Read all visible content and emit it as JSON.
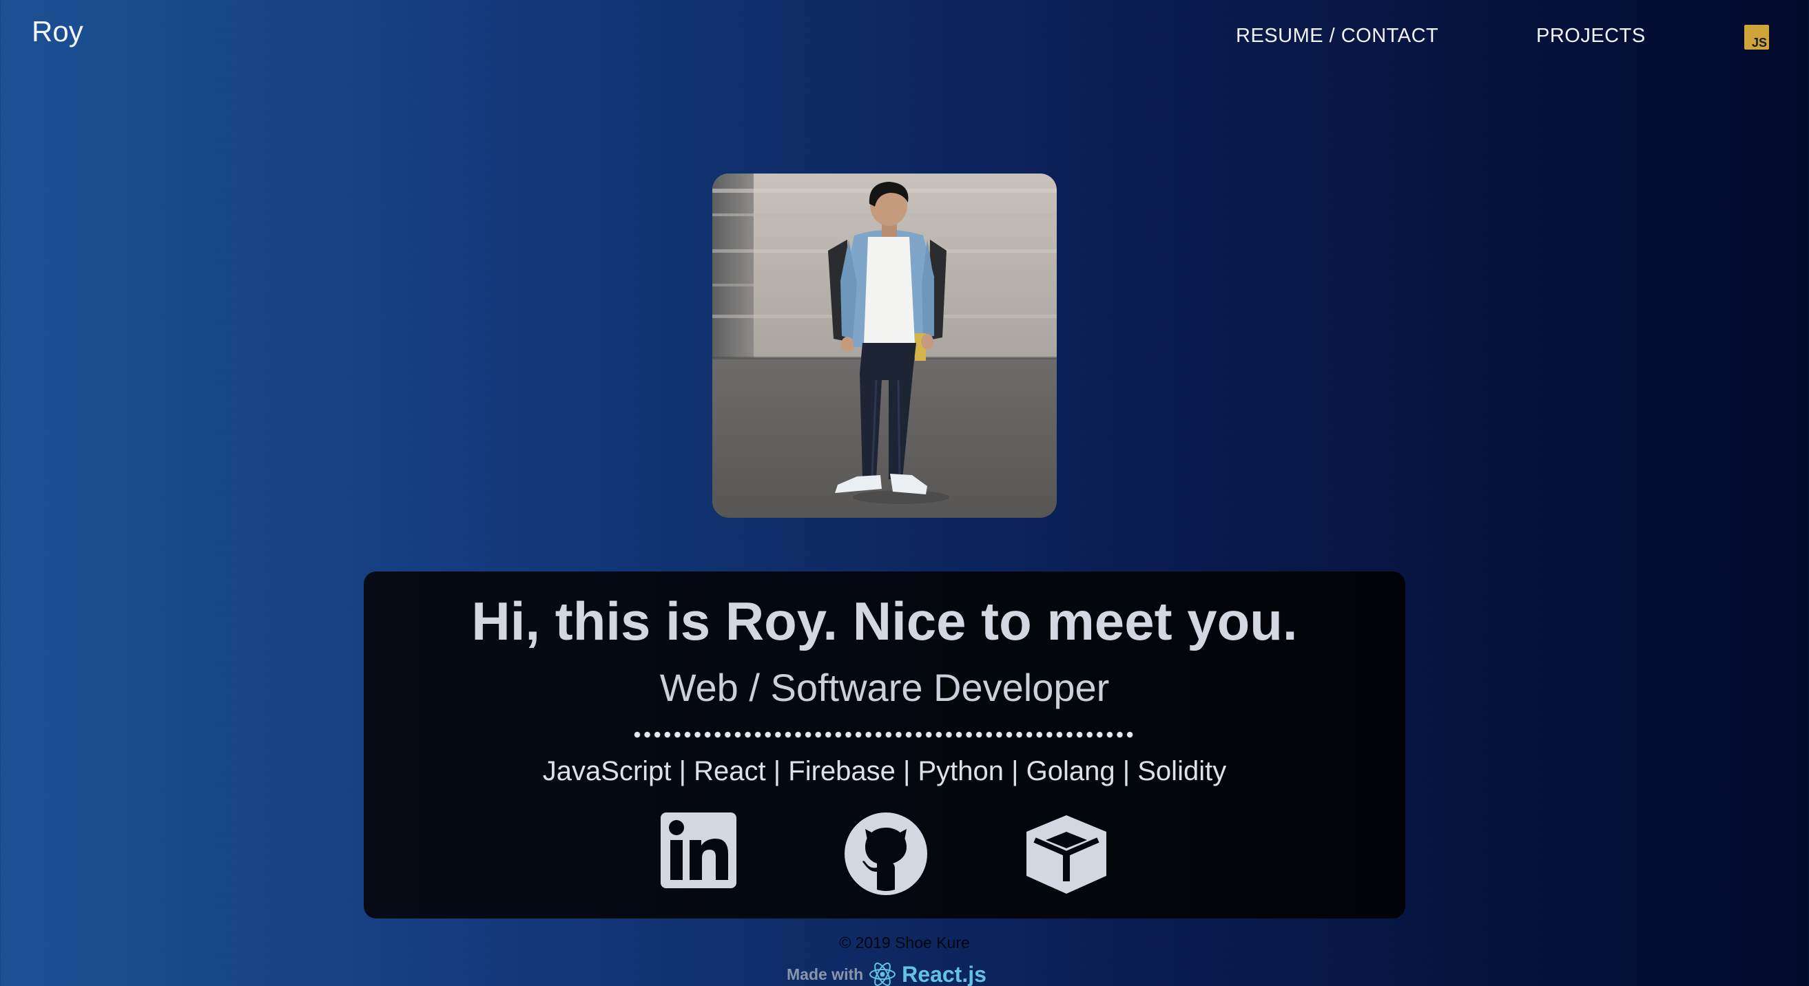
{
  "nav": {
    "brand": "Roy",
    "links": [
      {
        "label": "RESUME / CONTACT"
      },
      {
        "label": "PROJECTS"
      }
    ],
    "js_badge": "JS",
    "colors": {
      "text": "#f2f4f8",
      "js_badge": "#cfa43a"
    }
  },
  "hero": {
    "photo_icon": "profile-photo",
    "headline": "Hi, this is Roy. Nice to meet you.",
    "subtitle": "Web / Software Developer",
    "skills": "JavaScript | React | Firebase | Python | Golang | Solidity",
    "social_icons": [
      "linkedin-icon",
      "github-icon",
      "package-icon"
    ]
  },
  "footer": {
    "copyright": "© 2019 Shoe Kure",
    "made_with": "Made with",
    "framework": "React.js",
    "framework_icon": "react-icon"
  },
  "colors": {
    "background_left": "#1c5193",
    "background_right": "#020a2c",
    "card": "#04070f",
    "text": "#d3d7e1",
    "react_accent": "#61c3e8"
  }
}
